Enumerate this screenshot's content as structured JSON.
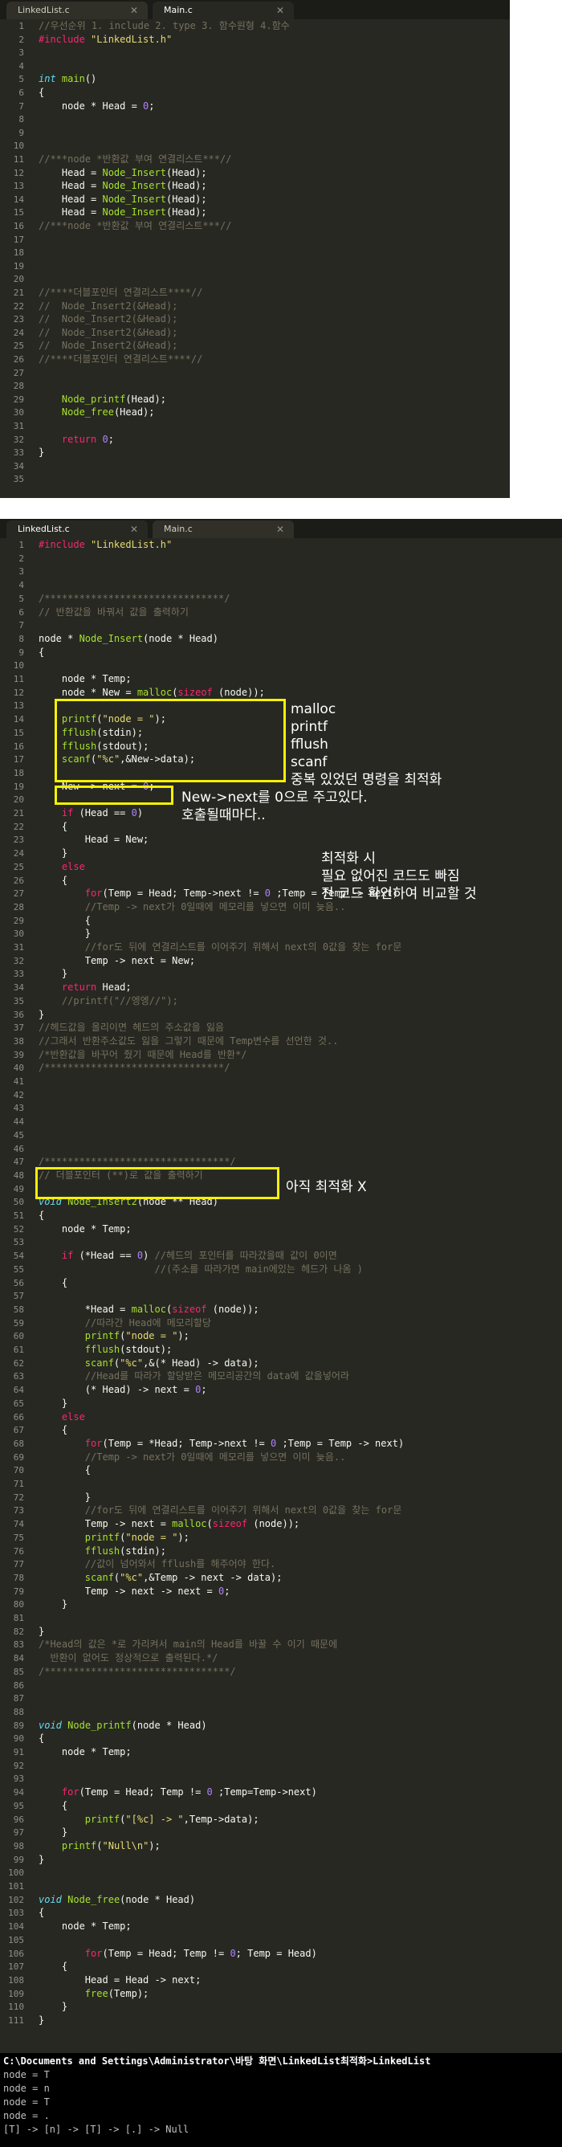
{
  "editor1": {
    "tabs": [
      {
        "label": "LinkedList.c",
        "active": false
      },
      {
        "label": "Main.c",
        "active": true
      }
    ],
    "lines": [
      {
        "n": "1",
        "h": "<span class='c'>//우선순위 1. include 2. type 3. 함수원형 4.함수</span>"
      },
      {
        "n": "2",
        "h": "<span class='k'>#include</span> <span class='s'>\"LinkedList.h\"</span>"
      },
      {
        "n": "3",
        "h": ""
      },
      {
        "n": "4",
        "h": ""
      },
      {
        "n": "5",
        "h": "<span class='t'>int</span> <span class='f'>main</span>()"
      },
      {
        "n": "6",
        "h": "{"
      },
      {
        "n": "7",
        "h": "    node * Head = <span class='n'>0</span>;"
      },
      {
        "n": "8",
        "h": ""
      },
      {
        "n": "9",
        "h": ""
      },
      {
        "n": "10",
        "h": ""
      },
      {
        "n": "11",
        "h": "<span class='c'>//***node *반환값 부여 연결리스트***//</span>"
      },
      {
        "n": "12",
        "h": "    Head = <span class='f'>Node_Insert</span>(Head);"
      },
      {
        "n": "13",
        "h": "    Head = <span class='f'>Node_Insert</span>(Head);"
      },
      {
        "n": "14",
        "h": "    Head = <span class='f'>Node_Insert</span>(Head);"
      },
      {
        "n": "15",
        "h": "    Head = <span class='f'>Node_Insert</span>(Head);"
      },
      {
        "n": "16",
        "h": "<span class='c'>//***node *반환값 부여 연결리스트***//</span>"
      },
      {
        "n": "17",
        "h": ""
      },
      {
        "n": "18",
        "h": ""
      },
      {
        "n": "19",
        "h": ""
      },
      {
        "n": "20",
        "h": ""
      },
      {
        "n": "21",
        "h": "<span class='c'>//****더블포인터 연결리스트****//</span>"
      },
      {
        "n": "22",
        "h": "<span class='c'>//  Node_Insert2(&amp;Head);</span>"
      },
      {
        "n": "23",
        "h": "<span class='c'>//  Node_Insert2(&amp;Head);</span>"
      },
      {
        "n": "24",
        "h": "<span class='c'>//  Node_Insert2(&amp;Head);</span>"
      },
      {
        "n": "25",
        "h": "<span class='c'>//  Node_Insert2(&amp;Head);</span>"
      },
      {
        "n": "26",
        "h": "<span class='c'>//****더블포인터 연결리스트****//</span>"
      },
      {
        "n": "27",
        "h": ""
      },
      {
        "n": "28",
        "h": ""
      },
      {
        "n": "29",
        "h": "    <span class='f'>Node_printf</span>(Head);"
      },
      {
        "n": "30",
        "h": "    <span class='f'>Node_free</span>(Head);"
      },
      {
        "n": "31",
        "h": ""
      },
      {
        "n": "32",
        "h": "    <span class='k'>return</span> <span class='n'>0</span>;"
      },
      {
        "n": "33",
        "h": "}"
      },
      {
        "n": "34",
        "h": ""
      },
      {
        "n": "35",
        "h": ""
      }
    ]
  },
  "editor2": {
    "tabs": [
      {
        "label": "LinkedList.c",
        "active": true
      },
      {
        "label": "Main.c",
        "active": false
      }
    ],
    "lines": [
      {
        "n": "1",
        "h": "<span class='k'>#include</span> <span class='s'>\"LinkedList.h\"</span>"
      },
      {
        "n": "2",
        "h": ""
      },
      {
        "n": "3",
        "h": ""
      },
      {
        "n": "4",
        "h": ""
      },
      {
        "n": "5",
        "h": "<span class='c'>/*******************************/</span>"
      },
      {
        "n": "6",
        "h": "<span class='c'>// 반환값을 바꿔서 값을 출력하기</span>"
      },
      {
        "n": "7",
        "h": ""
      },
      {
        "n": "8",
        "h": "node * <span class='f'>Node_Insert</span>(node * Head)"
      },
      {
        "n": "9",
        "h": "{"
      },
      {
        "n": "10",
        "h": ""
      },
      {
        "n": "11",
        "h": "    node * Temp;"
      },
      {
        "n": "12",
        "h": "    node * New = <span class='f'>malloc</span>(<span class='k'>sizeof</span> (node));"
      },
      {
        "n": "13",
        "h": ""
      },
      {
        "n": "14",
        "h": "    <span class='f'>printf</span>(<span class='s'>\"node = \"</span>);"
      },
      {
        "n": "15",
        "h": "    <span class='f'>fflush</span>(stdin);"
      },
      {
        "n": "16",
        "h": "    <span class='f'>fflush</span>(stdout);"
      },
      {
        "n": "17",
        "h": "    <span class='f'>scanf</span>(<span class='s'>\"%c\"</span>,&amp;New-&gt;data);"
      },
      {
        "n": "18",
        "h": ""
      },
      {
        "n": "19",
        "h": "    New -&gt; next = <span class='n'>0</span>;"
      },
      {
        "n": "20",
        "h": ""
      },
      {
        "n": "21",
        "h": "    <span class='k'>if</span> (Head == <span class='n'>0</span>)"
      },
      {
        "n": "22",
        "h": "    {"
      },
      {
        "n": "23",
        "h": "        Head = New;"
      },
      {
        "n": "24",
        "h": "    }"
      },
      {
        "n": "25",
        "h": "    <span class='k'>else</span>"
      },
      {
        "n": "26",
        "h": "    {"
      },
      {
        "n": "27",
        "h": "        <span class='k'>for</span>(Temp = Head; Temp-&gt;next != <span class='n'>0</span> ;Temp = Temp -&gt; next)"
      },
      {
        "n": "28",
        "h": "        <span class='c'>//Temp -&gt; next가 0일때에 메모리를 넣으면 이미 늦음..</span>"
      },
      {
        "n": "29",
        "h": "        {"
      },
      {
        "n": "30",
        "h": "        }"
      },
      {
        "n": "31",
        "h": "        <span class='c'>//for도 뒤에 연결리스트를 이어주기 위해서 next의 0값을 찾는 for문</span>"
      },
      {
        "n": "32",
        "h": "        Temp -&gt; next = New;"
      },
      {
        "n": "33",
        "h": "    }"
      },
      {
        "n": "34",
        "h": "    <span class='k'>return</span> Head;"
      },
      {
        "n": "35",
        "h": "    <span class='c'>//printf(\"//엥엥//\");</span>"
      },
      {
        "n": "36",
        "h": "}"
      },
      {
        "n": "37",
        "h": "<span class='c'>//헤드값을 올리이면 헤드의 주소값을 잃음</span>"
      },
      {
        "n": "38",
        "h": "<span class='c'>//그래서 반환주소값도 잃을 그렇기 때문에 Temp변수를 선언한 것..</span>"
      },
      {
        "n": "39",
        "h": "<span class='c'>/*반환값을 바꾸어 줬기 때문에 Head를 반환*/</span>"
      },
      {
        "n": "40",
        "h": "<span class='c'>/*******************************/</span>"
      },
      {
        "n": "41",
        "h": ""
      },
      {
        "n": "42",
        "h": ""
      },
      {
        "n": "43",
        "h": ""
      },
      {
        "n": "44",
        "h": ""
      },
      {
        "n": "45",
        "h": ""
      },
      {
        "n": "46",
        "h": ""
      },
      {
        "n": "47",
        "h": "<span class='c'>/********************************/</span>"
      },
      {
        "n": "48",
        "h": "<span class='c'>// 더블포인터 (**)로 값을 출력하기</span>"
      },
      {
        "n": "49",
        "h": ""
      },
      {
        "n": "50",
        "h": "<span class='t'>void</span> <span class='f'>Node_Insert2</span>(node ** Head)"
      },
      {
        "n": "51",
        "h": "{"
      },
      {
        "n": "52",
        "h": "    node * Temp;"
      },
      {
        "n": "53",
        "h": ""
      },
      {
        "n": "54",
        "h": "    <span class='k'>if</span> (*Head == <span class='n'>0</span>) <span class='c'>//헤드의 포인터를 따라갔을때 값이 0이면</span>"
      },
      {
        "n": "55",
        "h": "                    <span class='c'>//(주소를 따라가면 main에있는 헤드가 나옴 )</span>"
      },
      {
        "n": "56",
        "h": "    {"
      },
      {
        "n": "57",
        "h": ""
      },
      {
        "n": "58",
        "h": "        *Head = <span class='f'>malloc</span>(<span class='k'>sizeof</span> (node));"
      },
      {
        "n": "59",
        "h": "        <span class='c'>//따라간 Head에 메모리할당</span>"
      },
      {
        "n": "60",
        "h": "        <span class='f'>printf</span>(<span class='s'>\"node = \"</span>);"
      },
      {
        "n": "61",
        "h": "        <span class='f'>fflush</span>(stdout);"
      },
      {
        "n": "62",
        "h": "        <span class='f'>scanf</span>(<span class='s'>\"%c\"</span>,&amp;(* Head) -&gt; data);"
      },
      {
        "n": "63",
        "h": "        <span class='c'>//Head를 따라가 할당받은 메모리공간의 data에 값을넣어라</span>"
      },
      {
        "n": "64",
        "h": "        (* Head) -&gt; next = <span class='n'>0</span>;"
      },
      {
        "n": "65",
        "h": "    }"
      },
      {
        "n": "66",
        "h": "    <span class='k'>else</span>"
      },
      {
        "n": "67",
        "h": "    {"
      },
      {
        "n": "68",
        "h": "        <span class='k'>for</span>(Temp = *Head; Temp-&gt;next != <span class='n'>0</span> ;Temp = Temp -&gt; next)"
      },
      {
        "n": "69",
        "h": "        <span class='c'>//Temp -&gt; next가 0일때에 메모리를 넣으면 이미 늦음..</span>"
      },
      {
        "n": "70",
        "h": "        {"
      },
      {
        "n": "71",
        "h": ""
      },
      {
        "n": "72",
        "h": "        }"
      },
      {
        "n": "73",
        "h": "        <span class='c'>//for도 뒤에 연결리스트를 이어주기 위해서 next의 0값을 찾는 for문</span>"
      },
      {
        "n": "74",
        "h": "        Temp -&gt; next = <span class='f'>malloc</span>(<span class='k'>sizeof</span> (node));"
      },
      {
        "n": "75",
        "h": "        <span class='f'>printf</span>(<span class='s'>\"node = \"</span>);"
      },
      {
        "n": "76",
        "h": "        <span class='f'>fflush</span>(stdin);"
      },
      {
        "n": "77",
        "h": "        <span class='c'>//값이 넘어와서 fflush를 해주어야 한다.</span>"
      },
      {
        "n": "78",
        "h": "        <span class='f'>scanf</span>(<span class='s'>\"%c\"</span>,&amp;Temp -&gt; next -&gt; data);"
      },
      {
        "n": "79",
        "h": "        Temp -&gt; next -&gt; next = <span class='n'>0</span>;"
      },
      {
        "n": "80",
        "h": "    }"
      },
      {
        "n": "81",
        "h": ""
      },
      {
        "n": "82",
        "h": "}"
      },
      {
        "n": "83",
        "h": "<span class='c'>/*Head의 값은 *로 가리켜서 main의 Head를 바꿀 수 이기 때문에</span>"
      },
      {
        "n": "84",
        "h": "<span class='c'>  반환이 없어도 정상적으로 출력된다.*/</span>"
      },
      {
        "n": "85",
        "h": "<span class='c'>/********************************/</span>"
      },
      {
        "n": "86",
        "h": ""
      },
      {
        "n": "87",
        "h": ""
      },
      {
        "n": "88",
        "h": ""
      },
      {
        "n": "89",
        "h": "<span class='t'>void</span> <span class='f'>Node_printf</span>(node * Head)"
      },
      {
        "n": "90",
        "h": "{"
      },
      {
        "n": "91",
        "h": "    node * Temp;"
      },
      {
        "n": "92",
        "h": ""
      },
      {
        "n": "93",
        "h": ""
      },
      {
        "n": "94",
        "h": "    <span class='k'>for</span>(Temp = Head; Temp != <span class='n'>0</span> ;Temp=Temp-&gt;next)"
      },
      {
        "n": "95",
        "h": "    {"
      },
      {
        "n": "96",
        "h": "        <span class='f'>printf</span>(<span class='s'>\"[%c] -&gt; \"</span>,Temp-&gt;data);"
      },
      {
        "n": "97",
        "h": "    }"
      },
      {
        "n": "98",
        "h": "    <span class='f'>printf</span>(<span class='s'>\"Null\\n\"</span>);"
      },
      {
        "n": "99",
        "h": "}"
      },
      {
        "n": "100",
        "h": ""
      },
      {
        "n": "101",
        "h": ""
      },
      {
        "n": "102",
        "h": "<span class='t'>void</span> <span class='f'>Node_free</span>(node * Head)"
      },
      {
        "n": "103",
        "h": "{"
      },
      {
        "n": "104",
        "h": "    node * Temp;"
      },
      {
        "n": "105",
        "h": ""
      },
      {
        "n": "106",
        "h": "        <span class='k'>for</span>(Temp = Head; Temp != <span class='n'>0</span>; Temp = Head)"
      },
      {
        "n": "107",
        "h": "    {"
      },
      {
        "n": "108",
        "h": "        Head = Head -&gt; next;"
      },
      {
        "n": "109",
        "h": "        <span class='f'>free</span>(Temp);"
      },
      {
        "n": "110",
        "h": "    }"
      },
      {
        "n": "111",
        "h": "}"
      }
    ]
  },
  "annotations": {
    "a1": "malloc\nprintf\nfflush\nscanf\n중복 있었던 명령을 최적화",
    "a2": "New->next를 0으로 주고있다.\n호출될때마다..",
    "a3": "최적화 시\n필요 없어진 코드도 빠짐\n전 코드 확인하여 비교할 것",
    "a4": "아직 최적화 X"
  },
  "console": {
    "lines": [
      "C:\\Documents and Settings\\Administrator\\바탕 화면\\LinkedList최적화>LinkedList",
      "node = T",
      "node = n",
      "node = T",
      "node = .",
      "[T] -> [n] -> [T] -> [.] -> Null"
    ]
  }
}
